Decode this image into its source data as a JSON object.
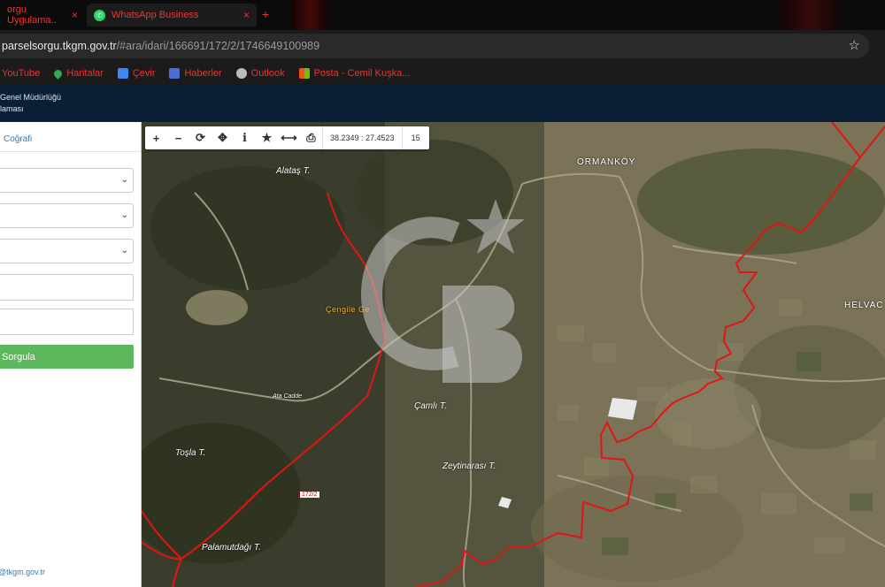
{
  "browser": {
    "tabs": [
      {
        "label": "orgu Uygulama..",
        "active": false
      },
      {
        "label": "WhatsApp Business",
        "active": true
      }
    ],
    "new_tab_glyph": "+",
    "close_glyph": "×",
    "address": {
      "host": "parselsorgu.tkgm.gov.tr",
      "path": "/#ara/idari/166691/172/2/1746649100989"
    },
    "bookmarks": [
      {
        "label": "YouTube",
        "icon": "youtube-icon",
        "color": "#e62117"
      },
      {
        "label": "Haritalar",
        "icon": "maps-pin-icon",
        "color": "#34a853"
      },
      {
        "label": "Çevir",
        "icon": "translate-icon",
        "color": "#4285f4"
      },
      {
        "label": "Haberler",
        "icon": "news-icon",
        "color": "#4a6ed8"
      },
      {
        "label": "Outlook",
        "icon": "globe-icon",
        "color": "#bbbbbb"
      },
      {
        "label": "Posta - Cemil Kuşka...",
        "icon": "microsoft-icon",
        "color": "#f25022"
      }
    ]
  },
  "site": {
    "header_line1": "Genel Müdürlüğü",
    "header_line2": "laması"
  },
  "sidebar": {
    "tab_label": "Coğrafi",
    "query_button": "Sorgula",
    "footer_email": "@tkgm.gov.tr",
    "select_count": 3,
    "input_count": 2
  },
  "map": {
    "toolbar": {
      "zoom_in": "+",
      "zoom_out": "−",
      "refresh": "⟳",
      "locate": "✥",
      "info": "i",
      "favorite": "★",
      "measure": "⟷",
      "print": "⎙",
      "coordinates": "38.2349 : 27.4523",
      "zoom_level": "15"
    },
    "labels": {
      "alatas": "Alataş T.",
      "cengile": "Çengile Ge",
      "camli": "Çamlı T.",
      "zeytinarasi": "Zeytinarası T.",
      "tosla": "Toşla T.",
      "palamutdagi": "Palamutdağı T.",
      "ormankoy": "ORMANKÖY",
      "helvaci": "HELVAC",
      "ata_cadde": "Ata Cadde",
      "parcel": "172/2"
    },
    "watermark": "CB",
    "colors": {
      "boundary": "#e01515",
      "watermark": "#c8c8c8"
    }
  }
}
